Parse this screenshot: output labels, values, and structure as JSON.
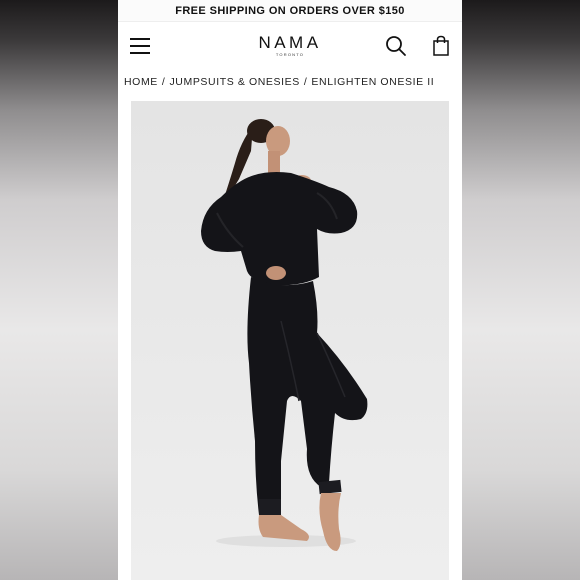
{
  "promo_banner": {
    "text": "FREE SHIPPING ON ORDERS OVER $150"
  },
  "header": {
    "logo_main": "NAMA",
    "logo_sub": "TORONTO",
    "icons": {
      "menu": "hamburger-menu-icon",
      "search": "search-icon",
      "bag": "shopping-bag-icon"
    }
  },
  "breadcrumb": {
    "items": [
      "HOME",
      "JUMPSUITS & ONESIES",
      "ENLIGHTEN ONESIE II"
    ],
    "separator": "/"
  },
  "product": {
    "image_alt": "Model wearing black Enlighten Onesie II"
  },
  "colors": {
    "garment": "#141418",
    "background": "#e6e6e6",
    "text": "#111111"
  }
}
